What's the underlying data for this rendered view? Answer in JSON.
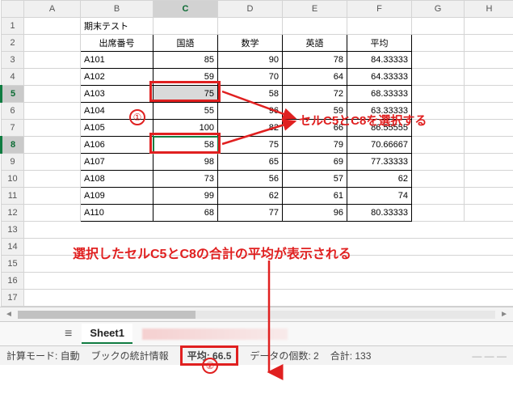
{
  "columns": [
    "A",
    "B",
    "C",
    "D",
    "E",
    "F",
    "G",
    "H"
  ],
  "title": "期末テスト",
  "headers": {
    "id": "出席番号",
    "kokugo": "国語",
    "sugaku": "数学",
    "eigo": "英語",
    "heikin": "平均"
  },
  "rows": [
    {
      "id": "A101",
      "k": 85,
      "s": 90,
      "e": 78,
      "avg": "84.33333"
    },
    {
      "id": "A102",
      "k": 59,
      "s": 70,
      "e": 64,
      "avg": "64.33333"
    },
    {
      "id": "A103",
      "k": 75,
      "s": 58,
      "e": 72,
      "avg": "68.33333"
    },
    {
      "id": "A104",
      "k": 55,
      "s": 96,
      "e": 59,
      "avg": "63.33333"
    },
    {
      "id": "A105",
      "k": 100,
      "s": 82,
      "e": 66,
      "avg": "86.55555"
    },
    {
      "id": "A106",
      "k": 58,
      "s": 75,
      "e": 79,
      "avg": "70.66667"
    },
    {
      "id": "A107",
      "k": 98,
      "s": 65,
      "e": 69,
      "avg": "77.33333"
    },
    {
      "id": "A108",
      "k": 73,
      "s": 56,
      "e": 57,
      "avg": "62"
    },
    {
      "id": "A109",
      "k": 99,
      "s": 62,
      "e": 61,
      "avg": "74"
    },
    {
      "id": "A110",
      "k": 68,
      "s": 77,
      "e": 96,
      "avg": "80.33333"
    }
  ],
  "ann": {
    "n1": "①",
    "n2": "②",
    "sel_note": "セルC5とC8を選択する",
    "avg_note": "選択したセルC5とC8の合計の平均が表示される"
  },
  "tab": {
    "name": "Sheet1"
  },
  "status": {
    "calc": "計算モード: 自動",
    "book": "ブックの統計情報",
    "avg": "平均: 66.5",
    "count": "データの個数: 2",
    "sum": "合計: 133",
    "dash": "— — —"
  },
  "chart_data": {
    "type": "table",
    "title": "期末テスト",
    "columns": [
      "出席番号",
      "国語",
      "数学",
      "英語",
      "平均"
    ],
    "rows": [
      [
        "A101",
        85,
        90,
        78,
        84.33333
      ],
      [
        "A102",
        59,
        70,
        64,
        64.33333
      ],
      [
        "A103",
        75,
        58,
        72,
        68.33333
      ],
      [
        "A104",
        55,
        96,
        59,
        63.33333
      ],
      [
        "A105",
        100,
        82,
        66,
        86.55555
      ],
      [
        "A106",
        58,
        75,
        79,
        70.66667
      ],
      [
        "A107",
        98,
        65,
        69,
        77.33333
      ],
      [
        "A108",
        73,
        56,
        57,
        62
      ],
      [
        "A109",
        99,
        62,
        61,
        74
      ],
      [
        "A110",
        68,
        77,
        96,
        80.33333
      ]
    ],
    "selection": [
      "C5",
      "C8"
    ],
    "status_aggregate": {
      "average": 66.5,
      "count": 2,
      "sum": 133
    }
  }
}
